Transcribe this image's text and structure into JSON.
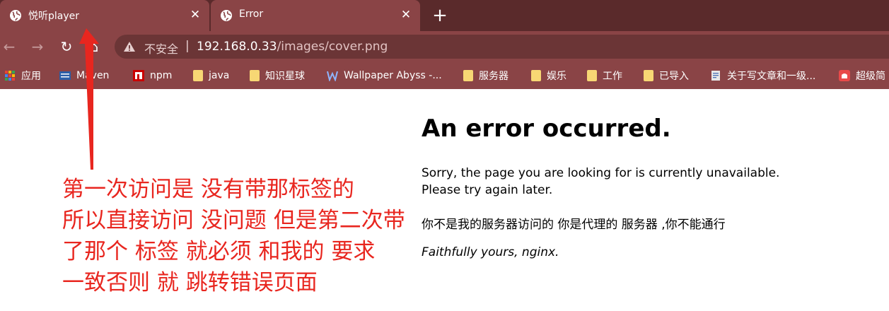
{
  "tabs": [
    {
      "title": "悦听player",
      "close": "✕"
    },
    {
      "title": "Error",
      "close": "✕"
    }
  ],
  "new_tab": "+",
  "toolbar": {
    "back": "←",
    "forward": "→",
    "reload": "↻",
    "home": "⌂",
    "security_label": "不安全",
    "separator": "|",
    "url_host": "192.168.0.33",
    "url_path": "/images/cover.png"
  },
  "bookmarks": [
    {
      "label": "应用",
      "icon": "apps-grid-icon"
    },
    {
      "label": "Maven",
      "icon": "maven-icon"
    },
    {
      "label": "npm",
      "icon": "npm-icon"
    },
    {
      "label": "java",
      "icon": "folder-icon"
    },
    {
      "label": "知识星球",
      "icon": "folder-icon"
    },
    {
      "label": "Wallpaper Abyss -...",
      "icon": "wallpaper-abyss-icon"
    },
    {
      "label": "服务器",
      "icon": "folder-icon"
    },
    {
      "label": "娱乐",
      "icon": "folder-icon"
    },
    {
      "label": "工作",
      "icon": "folder-icon"
    },
    {
      "label": "已导入",
      "icon": "folder-icon"
    },
    {
      "label": "关于写文章和一级...",
      "icon": "page-icon"
    },
    {
      "label": "超级简",
      "icon": "red-app-icon"
    }
  ],
  "page": {
    "title": "An error occurred.",
    "paragraph1_line1": "Sorry, the page you are looking for is currently unavailable.",
    "paragraph1_line2": "Please try again later.",
    "paragraph2": "你不是我的服务器访问的 你是代理的 服务器 ,你不能通行",
    "signature": "Faithfully yours, nginx."
  },
  "annotation": {
    "lines": [
      "第一次访问是 没有带那标签的",
      "所以直接访问 没问题 但是第二次带",
      "了那个 标签 就必须 和我的 要求",
      "一致否则 就 跳转错误页面"
    ],
    "color": "#e8261f"
  },
  "colors": {
    "tabstrip": "#5a2a2b",
    "toolbar": "#8a4446",
    "omnibox": "#6b3536"
  }
}
